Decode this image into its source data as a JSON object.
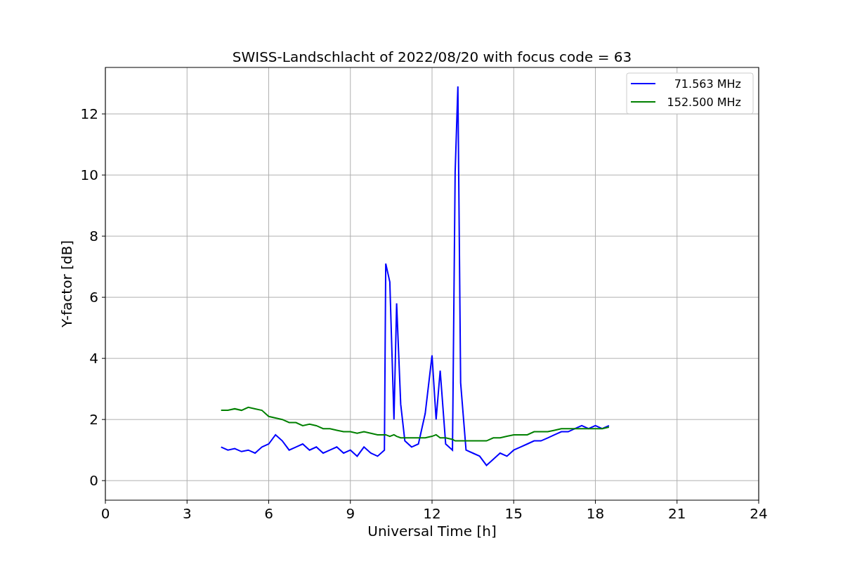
{
  "chart_data": {
    "type": "line",
    "title": "SWISS-Landschlacht of 2022/08/20 with focus code = 63",
    "xlabel": "Universal Time [h]",
    "ylabel": "Y-factor [dB]",
    "x": [
      4.25,
      4.5,
      4.75,
      5,
      5.25,
      5.5,
      5.75,
      6,
      6.25,
      6.5,
      6.75,
      7,
      7.25,
      7.5,
      7.75,
      8,
      8.25,
      8.5,
      8.75,
      9,
      9.25,
      9.5,
      9.75,
      10,
      10.25,
      10.3,
      10.45,
      10.6,
      10.7,
      10.85,
      11,
      11.25,
      11.5,
      11.75,
      12,
      12.15,
      12.3,
      12.5,
      12.75,
      12.85,
      12.95,
      13.05,
      13.25,
      13.5,
      13.75,
      14,
      14.25,
      14.5,
      14.75,
      15,
      15.25,
      15.5,
      15.75,
      16,
      16.25,
      16.5,
      16.75,
      17,
      17.25,
      17.5,
      17.75,
      18,
      18.25,
      18.5
    ],
    "series": [
      {
        "name": "71.563 MHz",
        "color": "#0000ff",
        "values": [
          1.1,
          1.0,
          1.05,
          0.95,
          1.0,
          0.9,
          1.1,
          1.2,
          1.5,
          1.3,
          1.0,
          1.1,
          1.2,
          1.0,
          1.1,
          0.9,
          1.0,
          1.1,
          0.9,
          1.0,
          0.8,
          1.1,
          0.9,
          0.8,
          1.0,
          7.1,
          6.5,
          2.0,
          5.8,
          2.5,
          1.3,
          1.1,
          1.2,
          2.2,
          4.1,
          2.0,
          3.6,
          1.2,
          1.0,
          10.1,
          12.9,
          3.2,
          1.0,
          0.9,
          0.8,
          0.5,
          0.7,
          0.9,
          0.8,
          1.0,
          1.1,
          1.2,
          1.3,
          1.3,
          1.4,
          1.5,
          1.6,
          1.6,
          1.7,
          1.8,
          1.7,
          1.8,
          1.7,
          1.8
        ]
      },
      {
        "name": "152.500 MHz",
        "color": "#008000",
        "values": [
          2.3,
          2.3,
          2.35,
          2.3,
          2.4,
          2.35,
          2.3,
          2.1,
          2.05,
          2.0,
          1.9,
          1.9,
          1.8,
          1.85,
          1.8,
          1.7,
          1.7,
          1.65,
          1.6,
          1.6,
          1.55,
          1.6,
          1.55,
          1.5,
          1.5,
          1.5,
          1.45,
          1.5,
          1.45,
          1.4,
          1.4,
          1.4,
          1.4,
          1.4,
          1.45,
          1.5,
          1.4,
          1.4,
          1.35,
          1.3,
          1.3,
          1.3,
          1.3,
          1.3,
          1.3,
          1.3,
          1.4,
          1.4,
          1.45,
          1.5,
          1.5,
          1.5,
          1.6,
          1.6,
          1.6,
          1.65,
          1.7,
          1.7,
          1.7,
          1.7,
          1.7,
          1.7,
          1.7,
          1.75
        ]
      }
    ],
    "grid": true,
    "legend": "upper right",
    "xlim": [
      0,
      24
    ],
    "ylim": [
      -0.64,
      13.52
    ],
    "xticks": [
      0,
      3,
      6,
      9,
      12,
      15,
      18,
      21,
      24
    ],
    "yticks": [
      0,
      2,
      4,
      6,
      8,
      10,
      12
    ]
  }
}
